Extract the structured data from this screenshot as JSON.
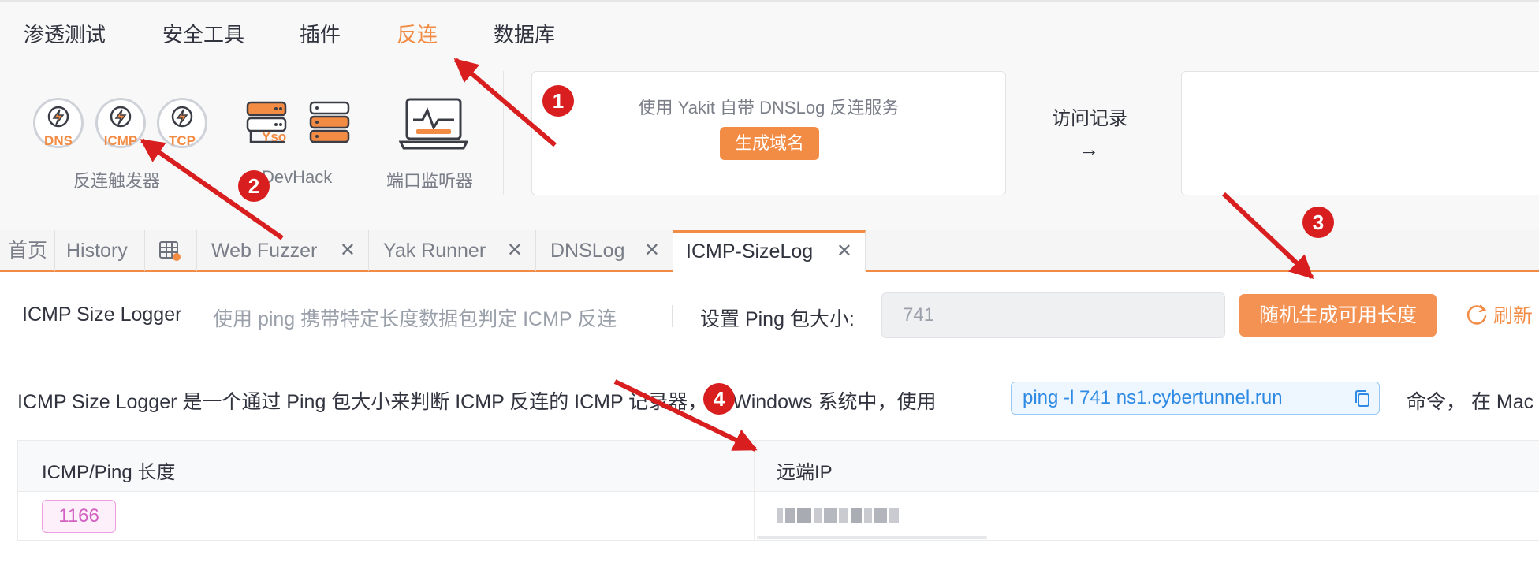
{
  "menu": [
    "渗透测试",
    "安全工具",
    "插件",
    "反连",
    "数据库"
  ],
  "menu_active": "反连",
  "triggers": [
    {
      "label": "DNS",
      "icon": "bolt-icon"
    },
    {
      "label": "ICMP",
      "icon": "bolt-icon"
    },
    {
      "label": "TCP",
      "icon": "bolt-icon"
    }
  ],
  "groups": {
    "trigger_label": "反连触发器",
    "devhack_label": "DevHack",
    "yso_label": "Yso",
    "port_label": "端口监听器"
  },
  "dnslog_card": {
    "description": "使用 Yakit 自带 DNSLog 反连服务",
    "button": "生成域名"
  },
  "visit": {
    "label": "访问记录",
    "arrow": "→"
  },
  "tabs": [
    {
      "label": "首页",
      "closable": false
    },
    {
      "label": "History",
      "closable": false
    },
    {
      "label": "",
      "icon": "table-icon",
      "closable": false
    },
    {
      "label": "Web Fuzzer",
      "closable": true
    },
    {
      "label": "Yak Runner",
      "closable": true
    },
    {
      "label": "DNSLog",
      "closable": true
    },
    {
      "label": "ICMP-SizeLog",
      "closable": true,
      "active": true
    }
  ],
  "close_glyph": "✕",
  "toolbar": {
    "title": "ICMP Size Logger",
    "subtitle": "使用 ping 携带特定长度数据包判定 ICMP 反连",
    "size_label": "设置 Ping 包大小:",
    "size_value": "741",
    "random_button": "随机生成可用长度",
    "refresh_label": "刷新"
  },
  "content": {
    "description": "ICMP Size Logger 是一个通过 Ping 包大小来判断 ICMP 反连的 ICMP 记录器，在 Windows 系统中，使用",
    "command": "ping -l 741 ns1.cybertunnel.run",
    "description_tail": "命令，  在 Mac"
  },
  "table": {
    "columns": [
      "ICMP/Ping 长度",
      "远端IP"
    ],
    "rows": [
      {
        "length": "1166",
        "remote_ip": "(blurred)"
      }
    ]
  },
  "annotations": [
    "1",
    "2",
    "3",
    "4"
  ],
  "colors": {
    "accent": "#f28b44",
    "annotation": "#d81e1e",
    "command": "#2f8ae3",
    "badge": "#d35fc1"
  }
}
